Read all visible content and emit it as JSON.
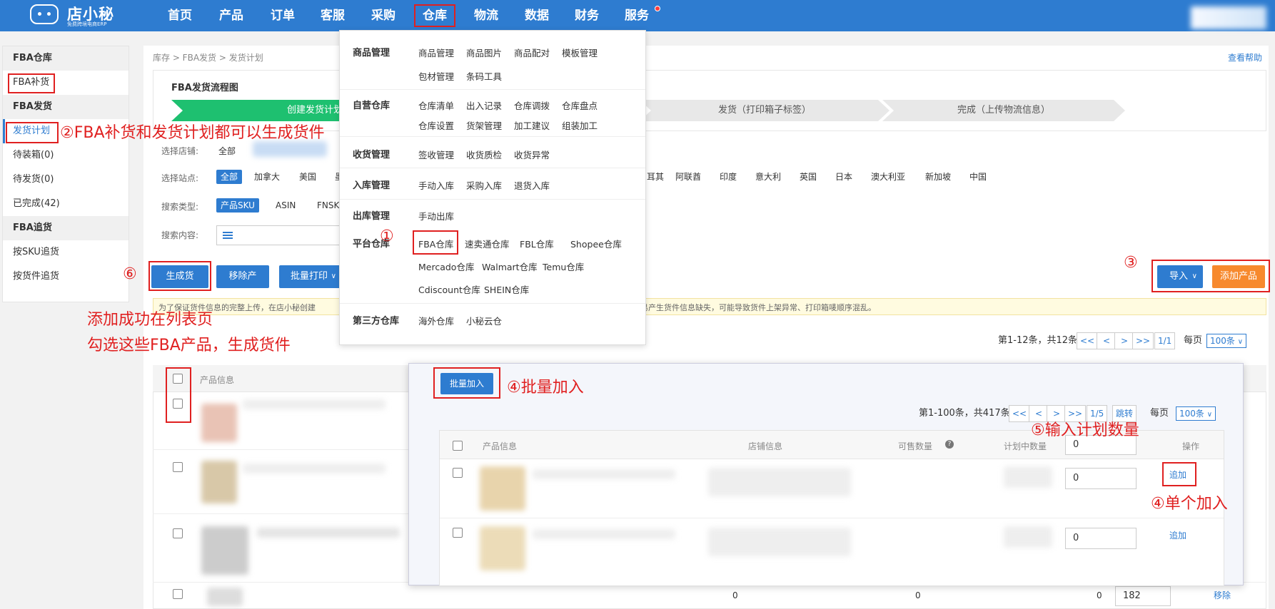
{
  "brand": {
    "name": "店小秘",
    "tagline": "免费跨境电商ERP"
  },
  "colors": {
    "nav_bg": "#2e7cd0",
    "accent_orange": "#f7892d",
    "annotation_red": "#e02020",
    "flow_green": "#1ec070"
  },
  "topnav": [
    "首页",
    "产品",
    "订单",
    "客服",
    "采购",
    "仓库",
    "物流",
    "数据",
    "财务",
    "服务"
  ],
  "sidebar": {
    "fba_warehouse": "FBA仓库",
    "fba_replenish": "FBA补货",
    "fba_shipping": "FBA发货",
    "shipping_plan": "发货计划",
    "to_pack": "待装箱(0)",
    "to_ship": "待发货(0)",
    "done": "已完成(42)",
    "fba_tracking": "FBA追货",
    "by_sku": "按SKU追货",
    "by_shipment": "按货件追货"
  },
  "breadcrumb": "库存 > FBA发货 > 发货计划",
  "help": "查看帮助",
  "flow": {
    "title": "FBA发货流程图",
    "steps": [
      "创建发货计划（添加产品）",
      "发货（打印箱子标签）",
      "完成（上传物流信息）"
    ]
  },
  "filters": {
    "shop_label": "选择店铺:",
    "shop_value": "全部",
    "site_label": "选择站点:",
    "sites_left": [
      "全部",
      "加拿大",
      "美国",
      "墨"
    ],
    "sites_right": [
      "耳其",
      "阿联酋",
      "印度",
      "意大利",
      "英国",
      "日本",
      "澳大利亚",
      "新加坡",
      "中国"
    ],
    "search_type_label": "搜索类型:",
    "search_types": [
      "产品SKU",
      "ASIN",
      "FNSK"
    ],
    "search_content_label": "搜索内容:"
  },
  "actions": {
    "generate": "生成货件",
    "remove": "移除产品",
    "batch_print": "批量打印",
    "import": "导入",
    "add_product": "添加产品"
  },
  "notice_left": "为了保证货件信息的完整上传，在店小秘创建",
  "notice_right": "容易产生货件信息缺失，可能导致货件上架异常、打印箱唛顺序混乱。",
  "main_pager": {
    "summary": "第1-12条，共12条",
    "buttons": [
      "<<",
      "<",
      ">",
      ">>"
    ],
    "page": "1/1",
    "per_page_label": "每页",
    "per_page": "100条"
  },
  "main_table": {
    "col_product": "产品信息",
    "row_values": [
      "0",
      "0",
      "0"
    ],
    "qty": "182",
    "remove": "移除"
  },
  "menu": {
    "product_mgmt": {
      "label": "商品管理",
      "items": [
        "商品管理",
        "商品图片",
        "商品配对",
        "模板管理",
        "包材管理",
        "条码工具"
      ]
    },
    "self_wh": {
      "label": "自营仓库",
      "items": [
        "仓库清单",
        "出入记录",
        "仓库调拨",
        "仓库盘点",
        "仓库设置",
        "货架管理",
        "加工建议",
        "组装加工"
      ]
    },
    "receive": {
      "label": "收货管理",
      "items": [
        "签收管理",
        "收货质检",
        "收货异常"
      ]
    },
    "inbound": {
      "label": "入库管理",
      "items": [
        "手动入库",
        "采购入库",
        "退货入库"
      ]
    },
    "outbound": {
      "label": "出库管理",
      "items": [
        "手动出库"
      ]
    },
    "platform": {
      "label": "平台仓库",
      "items": [
        "FBA仓库",
        "速卖通仓库",
        "FBL仓库",
        "Shopee仓库",
        "Mercado仓库",
        "Walmart仓库",
        "Temu仓库",
        "Cdiscount仓库",
        "SHEIN仓库"
      ]
    },
    "third": {
      "label": "第三方仓库",
      "items": [
        "海外仓库",
        "小秘云仓"
      ]
    }
  },
  "overlay": {
    "batch_add": "批量加入",
    "pager": {
      "summary": "第1-100条，共417条",
      "buttons": [
        "<<",
        "<",
        ">",
        ">>"
      ],
      "page": "1/5",
      "jump": "跳转",
      "per_page_label": "每页",
      "per_page": "100条"
    },
    "cols": {
      "product": "产品信息",
      "shop": "店铺信息",
      "available": "可售数量",
      "planned": "计划中数量",
      "action": "操作"
    },
    "header_qty": "0",
    "rows": [
      {
        "qty": "0",
        "action": "追加"
      },
      {
        "qty": "0",
        "action": "追加"
      }
    ]
  },
  "annotations": {
    "a1": "①",
    "a2": "②FBA补货和发货计划都可以生成货件",
    "a3": "③",
    "a4_batch": "④批量加入",
    "a4_single": "④单个加入",
    "a5": "⑤输入计划数量",
    "a6": "⑥",
    "a7_line1": "添加成功在列表页",
    "a7_line2": "勾选这些FBA产品，生成货件"
  }
}
